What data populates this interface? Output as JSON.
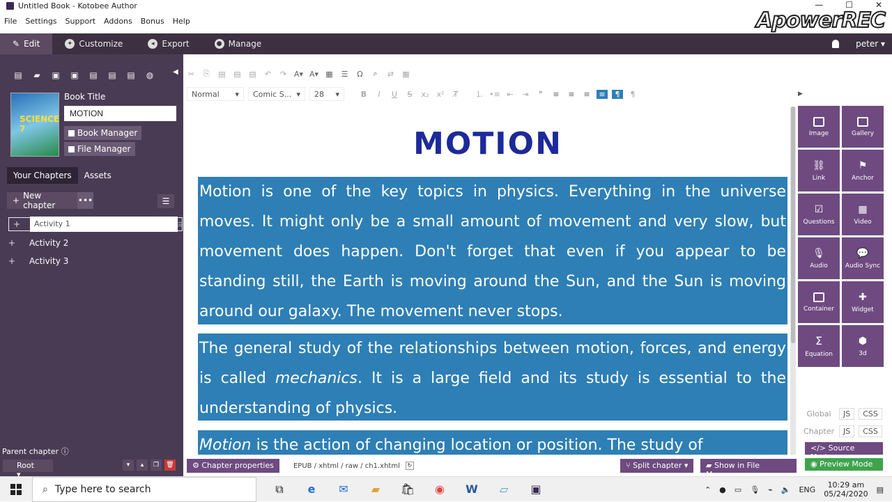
{
  "window": {
    "title": "Untitled Book - Kotobee Author",
    "minimize": "—",
    "maximize": "☐",
    "close": "✕"
  },
  "watermark": "ApowerREC",
  "menu": [
    "File",
    "Settings",
    "Support",
    "Addons",
    "Bonus",
    "Help"
  ],
  "tabs": [
    {
      "label": "Edit",
      "icon": "pencil-icon"
    },
    {
      "label": "Customize",
      "icon": "wrench-icon"
    },
    {
      "label": "Export",
      "icon": "export-icon"
    },
    {
      "label": "Manage",
      "icon": "user-icon"
    }
  ],
  "user": {
    "name": "peter ▾"
  },
  "book": {
    "title_label": "Book Title",
    "title_value": "MOTION",
    "cover_text": "SCIENCE 7",
    "book_manager": "Book Manager",
    "file_manager": "File Manager"
  },
  "sidebar": {
    "tab_chapters": "Your Chapters",
    "tab_assets": "Assets",
    "new_chapter": "New chapter",
    "more": "•••",
    "chapters": [
      {
        "label": "Activity 1"
      },
      {
        "label": "Activity 2"
      },
      {
        "label": "Activity 3"
      }
    ],
    "parent_chapter": "Parent chapter",
    "root": "Root ▾"
  },
  "format": {
    "style": "Normal",
    "font": "Comic S...",
    "size": "28"
  },
  "document": {
    "heading": "MOTION",
    "p1": "Motion is one of the key topics in physics. Everything in the universe moves. It might only be a small amount of movement and very slow, but movement does happen. Don't forget that even if you appear to be standing still, the Earth is moving around the Sun, and the Sun is moving around our galaxy. The movement never stops.",
    "p2a": "The general study of the relationships between motion, forces, and energy is called ",
    "p2em": "mechanics",
    "p2b": ". It is a large field and its study is essential to the understanding of physics.",
    "p3em": "Motion",
    "p3b": " is the action of changing location or position. The study of"
  },
  "right_panel": [
    {
      "label": "Image"
    },
    {
      "label": "Gallery"
    },
    {
      "label": "Link"
    },
    {
      "label": "Anchor"
    },
    {
      "label": "Questions"
    },
    {
      "label": "Video"
    },
    {
      "label": "Audio"
    },
    {
      "label": "Audio Sync"
    },
    {
      "label": "Container"
    },
    {
      "label": "Widget"
    },
    {
      "label": "Equation"
    },
    {
      "label": "3d"
    }
  ],
  "scopes": {
    "global": "Global",
    "chapter": "Chapter",
    "js": "JS",
    "css": "CSS"
  },
  "source_mode": "Source Mode",
  "preview_mode": "Preview Mode",
  "statusbar": {
    "chapter_properties": "Chapter properties",
    "path": "EPUB / xhtml / raw / ch1.xhtml",
    "split_chapter": "Split chapter",
    "show_in_file_manager": "Show in File Manager"
  },
  "taskbar": {
    "search_placeholder": "Type here to search",
    "lang": "ENG",
    "time": "10:29 am",
    "date": "05/24/2020"
  }
}
